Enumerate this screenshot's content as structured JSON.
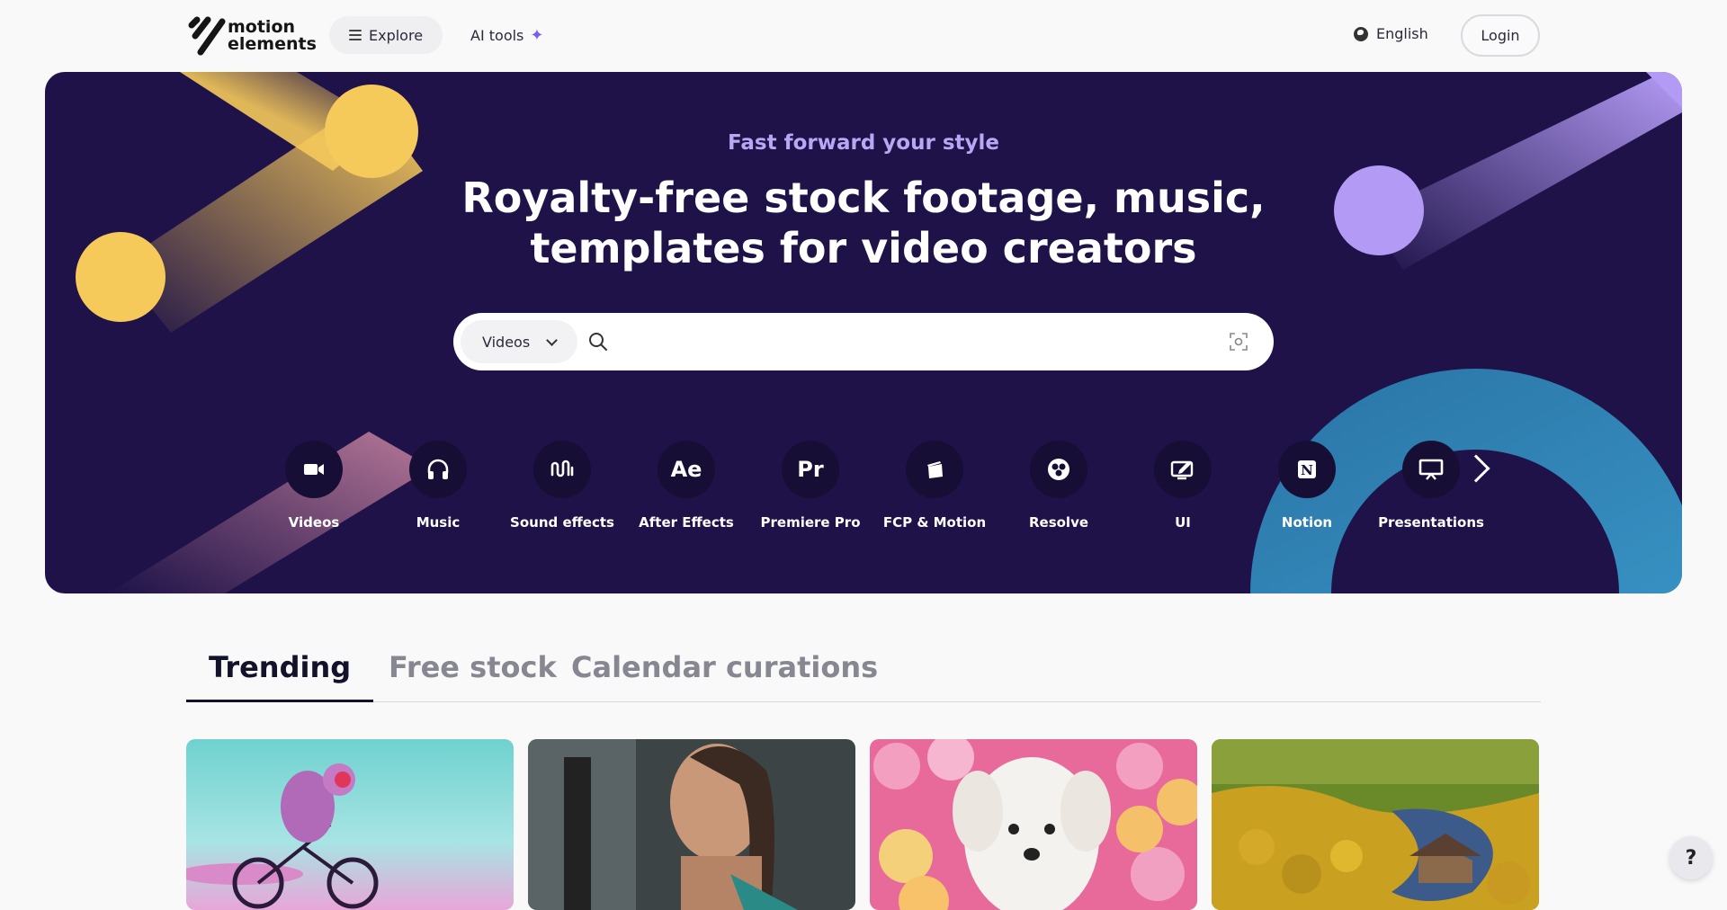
{
  "header": {
    "logo_line1": "motion",
    "logo_line2": "elements",
    "explore_label": "Explore",
    "ai_tools_label": "AI tools",
    "language_label": "English",
    "login_label": "Login"
  },
  "hero": {
    "tagline": "Fast forward your style",
    "headline_line1": "Royalty-free stock footage, music,",
    "headline_line2": "templates for video creators",
    "search": {
      "type_selected": "Videos",
      "placeholder": "",
      "value": ""
    },
    "categories": [
      {
        "label": "Videos",
        "icon": "video-camera-icon"
      },
      {
        "label": "Music",
        "icon": "headphones-icon"
      },
      {
        "label": "Sound effects",
        "icon": "sound-wave-icon"
      },
      {
        "label": "After Effects",
        "icon": "ae-icon",
        "glyph": "Ae"
      },
      {
        "label": "Premiere Pro",
        "icon": "pr-icon",
        "glyph": "Pr"
      },
      {
        "label": "FCP & Motion",
        "icon": "clapper-icon"
      },
      {
        "label": "Resolve",
        "icon": "resolve-icon"
      },
      {
        "label": "UI",
        "icon": "ui-icon"
      },
      {
        "label": "Notion",
        "icon": "notion-icon"
      },
      {
        "label": "Presentations",
        "icon": "presentation-icon"
      }
    ]
  },
  "tabs": [
    {
      "label": "Trending",
      "active": true
    },
    {
      "label": "Free stock",
      "active": false
    },
    {
      "label": "Calendar curations",
      "active": false
    }
  ],
  "help_label": "?",
  "colors": {
    "hero_bg": "#1e1248",
    "accent_yellow": "#f5c95a",
    "accent_purple": "#b39bf5",
    "accent_teal": "#2d8fc0",
    "tagline": "#b9a6f5"
  }
}
